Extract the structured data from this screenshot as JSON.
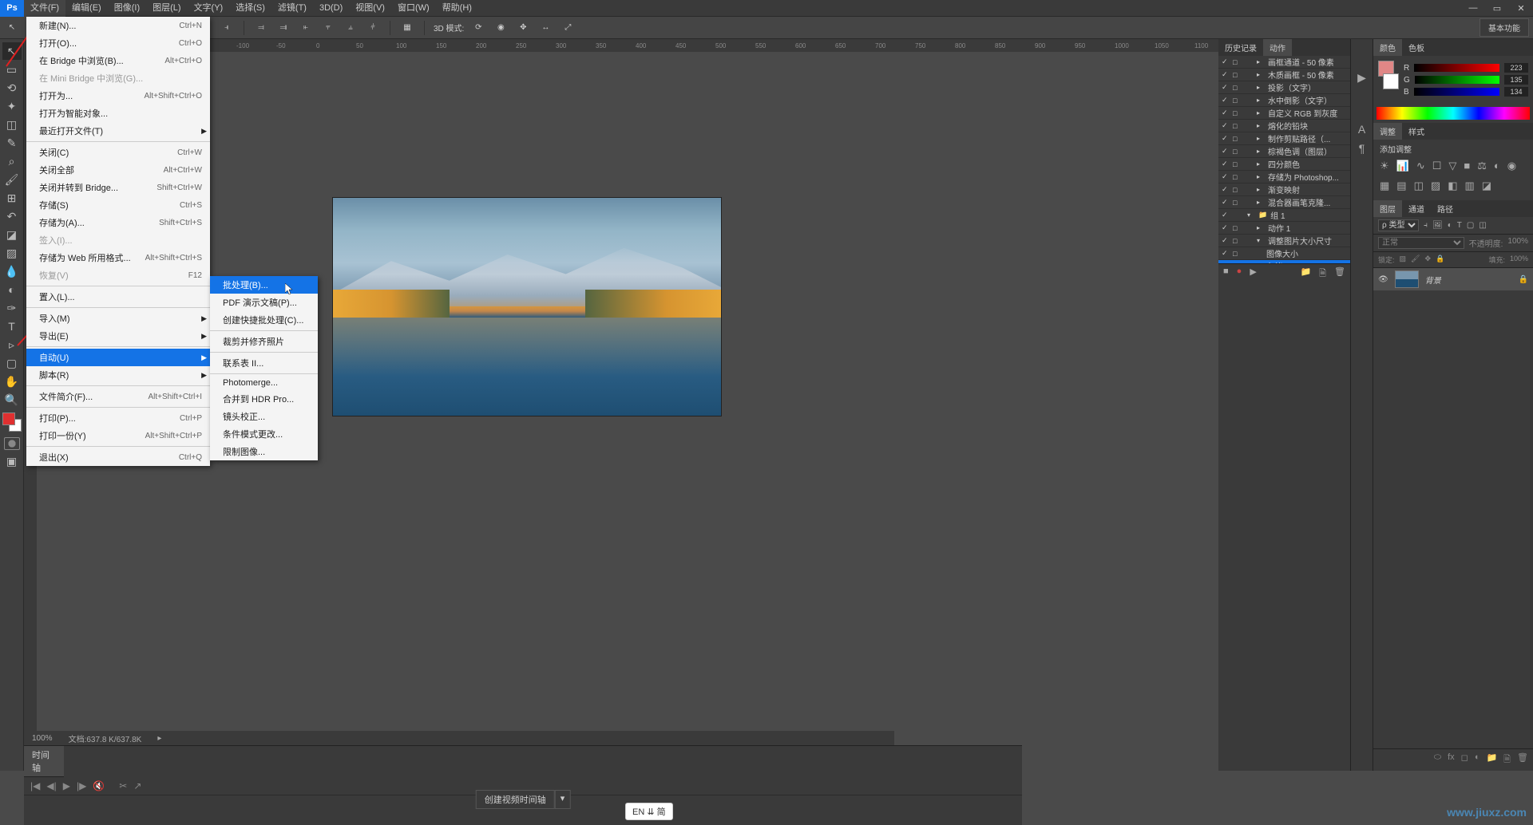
{
  "menubar": {
    "items": [
      "文件(F)",
      "编辑(E)",
      "图像(I)",
      "图层(L)",
      "文字(Y)",
      "选择(S)",
      "滤镜(T)",
      "3D(D)",
      "视图(V)",
      "窗口(W)",
      "帮助(H)"
    ]
  },
  "essentials_btn": "基本功能",
  "options": {
    "mode_3d": "3D 模式:"
  },
  "file_menu": [
    {
      "label": "新建(N)...",
      "shortcut": "Ctrl+N"
    },
    {
      "label": "打开(O)...",
      "shortcut": "Ctrl+O"
    },
    {
      "label": "在 Bridge 中浏览(B)...",
      "shortcut": "Alt+Ctrl+O"
    },
    {
      "label": "在 Mini Bridge 中浏览(G)...",
      "shortcut": "",
      "disabled": true
    },
    {
      "label": "打开为...",
      "shortcut": "Alt+Shift+Ctrl+O"
    },
    {
      "label": "打开为智能对象...",
      "shortcut": ""
    },
    {
      "label": "最近打开文件(T)",
      "shortcut": "",
      "sub": true
    },
    {
      "sep": true
    },
    {
      "label": "关闭(C)",
      "shortcut": "Ctrl+W"
    },
    {
      "label": "关闭全部",
      "shortcut": "Alt+Ctrl+W"
    },
    {
      "label": "关闭并转到 Bridge...",
      "shortcut": "Shift+Ctrl+W"
    },
    {
      "label": "存储(S)",
      "shortcut": "Ctrl+S"
    },
    {
      "label": "存储为(A)...",
      "shortcut": "Shift+Ctrl+S"
    },
    {
      "label": "签入(I)...",
      "shortcut": "",
      "disabled": true
    },
    {
      "label": "存储为 Web 所用格式...",
      "shortcut": "Alt+Shift+Ctrl+S"
    },
    {
      "label": "恢复(V)",
      "shortcut": "F12",
      "disabled": true
    },
    {
      "sep": true
    },
    {
      "label": "置入(L)...",
      "shortcut": ""
    },
    {
      "sep": true
    },
    {
      "label": "导入(M)",
      "shortcut": "",
      "sub": true
    },
    {
      "label": "导出(E)",
      "shortcut": "",
      "sub": true
    },
    {
      "sep": true
    },
    {
      "label": "自动(U)",
      "shortcut": "",
      "sub": true,
      "active": true
    },
    {
      "label": "脚本(R)",
      "shortcut": "",
      "sub": true
    },
    {
      "sep": true
    },
    {
      "label": "文件简介(F)...",
      "shortcut": "Alt+Shift+Ctrl+I"
    },
    {
      "sep": true
    },
    {
      "label": "打印(P)...",
      "shortcut": "Ctrl+P"
    },
    {
      "label": "打印一份(Y)",
      "shortcut": "Alt+Shift+Ctrl+P"
    },
    {
      "sep": true
    },
    {
      "label": "退出(X)",
      "shortcut": "Ctrl+Q"
    }
  ],
  "auto_submenu": [
    {
      "label": "批处理(B)...",
      "active": true
    },
    {
      "label": "PDF 演示文稿(P)..."
    },
    {
      "label": "创建快捷批处理(C)..."
    },
    {
      "sep": true
    },
    {
      "label": "裁剪并修齐照片"
    },
    {
      "sep": true
    },
    {
      "label": "联系表 II..."
    },
    {
      "sep": true
    },
    {
      "label": "Photomerge..."
    },
    {
      "label": "合并到 HDR Pro..."
    },
    {
      "label": "镜头校正..."
    },
    {
      "label": "条件模式更改..."
    },
    {
      "label": "限制图像..."
    }
  ],
  "status": {
    "zoom": "100%",
    "doc": "文档:637.8 K/637.8K"
  },
  "timeline": {
    "tab": "时间轴",
    "create": "创建视频时间轴"
  },
  "panel_tabs": {
    "history": "历史记录",
    "actions": "动作",
    "color": "颜色",
    "swatches": "色板",
    "adjustments": "调整",
    "styles": "样式",
    "layers": "图层",
    "channels": "通道",
    "paths": "路径"
  },
  "actions": [
    {
      "label": "画框通道 - 50 像素",
      "lvl": 2
    },
    {
      "label": "木质画框 - 50 像素",
      "lvl": 2
    },
    {
      "label": "投影（文字）",
      "lvl": 2
    },
    {
      "label": "水中倒影（文字）",
      "lvl": 2
    },
    {
      "label": "自定义 RGB 到灰度",
      "lvl": 2
    },
    {
      "label": "熔化的铅块",
      "lvl": 2
    },
    {
      "label": "制作剪贴路径（...",
      "lvl": 2
    },
    {
      "label": "棕褐色调（图层）",
      "lvl": 2
    },
    {
      "label": "四分颜色",
      "lvl": 2
    },
    {
      "label": "存储为 Photoshop...",
      "lvl": 2
    },
    {
      "label": "渐变映射",
      "lvl": 2
    },
    {
      "label": "混合器画笔克隆...",
      "lvl": 2
    },
    {
      "label": "组 1",
      "lvl": 1,
      "open": true,
      "folder": true
    },
    {
      "label": "动作 1",
      "lvl": 2
    },
    {
      "label": "调整图片大小尺寸",
      "lvl": 2,
      "open": true
    },
    {
      "label": "图像大小",
      "lvl": 3
    },
    {
      "label": "存储",
      "lvl": 3,
      "selected": true
    }
  ],
  "colors": {
    "r": "223",
    "g": "135",
    "b": "134"
  },
  "adjustments": {
    "title": "添加调整"
  },
  "layers": {
    "kind": "ρ 类型",
    "blend": "正常",
    "opacity_lbl": "不透明度:",
    "opacity": "100%",
    "lock_lbl": "锁定:",
    "fill_lbl": "填充:",
    "fill": "100%",
    "bg_layer": "背景"
  },
  "ime": "EN ⇊ 简"
}
